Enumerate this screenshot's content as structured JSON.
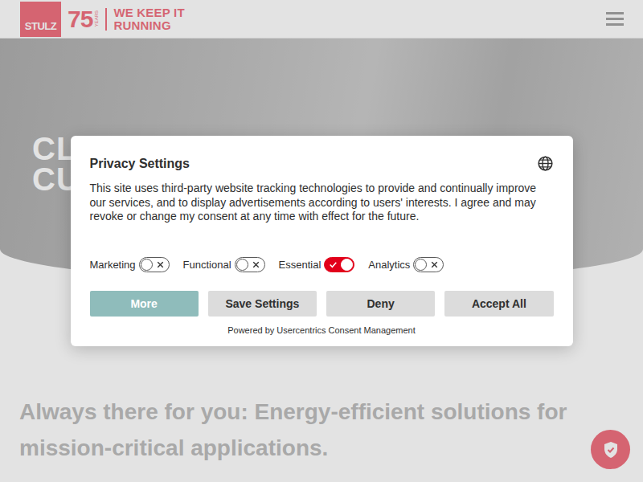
{
  "header": {
    "logo": "STULZ",
    "anniversary": "75",
    "anniversary_label": "YEARS",
    "tagline_top": "WE KEEP IT",
    "tagline_bottom": "RUNNING"
  },
  "hero": {
    "title_lines": [
      "CL",
      "CU"
    ]
  },
  "intro": {
    "heading": "Always there for you: Energy-efficient solutions for mission-critical applications."
  },
  "consent": {
    "title": "Privacy Settings",
    "text": "This site uses third-party website tracking technologies to provide and continually improve our services, and to display advertisements according to users' interests. I agree and may revoke or change my consent at any time with effect for the future.",
    "toggles": [
      {
        "label": "Marketing",
        "on": false
      },
      {
        "label": "Functional",
        "on": false
      },
      {
        "label": "Essential",
        "on": true
      },
      {
        "label": "Analytics",
        "on": false
      }
    ],
    "buttons": [
      {
        "label": "More",
        "kind": "primary"
      },
      {
        "label": "Save Settings",
        "kind": "secondary"
      },
      {
        "label": "Deny",
        "kind": "secondary"
      },
      {
        "label": "Accept All",
        "kind": "secondary"
      }
    ],
    "footer": "Powered by Usercentrics Consent Management"
  }
}
